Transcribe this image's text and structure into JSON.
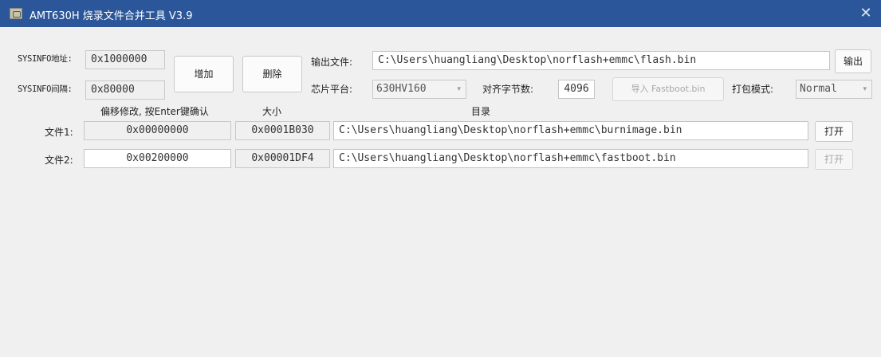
{
  "window": {
    "title": "AMT630H 烧录文件合并工具 V3.9",
    "close_glyph": "✕"
  },
  "sysinfo": {
    "address_label": "SYSINFO地址:",
    "address_value": "0x1000000",
    "interval_label": "SYSINFO间隔:",
    "interval_value": "0x80000"
  },
  "buttons": {
    "add": "增加",
    "delete": "删除",
    "output": "输出",
    "import_fastboot": "导入 Fastboot.bin"
  },
  "output": {
    "label": "输出文件:",
    "path": "C:\\Users\\huangliang\\Desktop\\norflash+emmc\\flash.bin"
  },
  "platform": {
    "label": "芯片平台:",
    "value": "630HV160"
  },
  "align": {
    "label": "对齐字节数:",
    "value": "4096"
  },
  "pack_mode": {
    "label": "打包模式:",
    "value": "Normal"
  },
  "columns": {
    "offset": "偏移修改, 按Enter键确认",
    "size": "大小",
    "directory": "目录"
  },
  "files": [
    {
      "label": "文件1:",
      "offset": "0x00000000",
      "size": "0x0001B030",
      "path": "C:\\Users\\huangliang\\Desktop\\norflash+emmc\\burnimage.bin",
      "open": "打开"
    },
    {
      "label": "文件2:",
      "offset": "0x00200000",
      "size": "0x00001DF4",
      "path": "C:\\Users\\huangliang\\Desktop\\norflash+emmc\\fastboot.bin",
      "open": "打开"
    }
  ],
  "colors": {
    "titlebar": "#2b579a",
    "background": "#f0f0f0"
  }
}
